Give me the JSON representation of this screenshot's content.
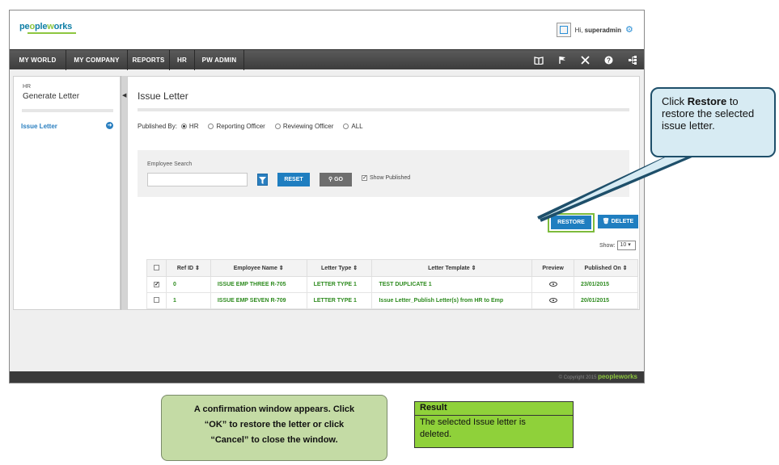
{
  "header": {
    "logo": "peopleworks",
    "greeting_prefix": "Hi,",
    "username": "superadmin"
  },
  "nav": {
    "items": [
      "MY WORLD",
      "MY COMPANY",
      "REPORTS",
      "HR",
      "PW ADMIN"
    ],
    "icons": [
      "book-icon",
      "flag-icon",
      "tools-icon",
      "help-icon",
      "sitemap-icon"
    ]
  },
  "sidebar": {
    "section": "HR",
    "title": "Generate Letter",
    "items": [
      {
        "label": "Issue Letter"
      }
    ]
  },
  "main": {
    "title": "Issue Letter",
    "published_by_label": "Published By:",
    "published_by_options": [
      "HR",
      "Reporting Officer",
      "Reviewing Officer",
      "ALL"
    ],
    "published_by_selected": "HR",
    "search": {
      "label": "Employee Search",
      "value": "",
      "reset_label": "RESET",
      "go_label": "GO",
      "show_published_label": "Show Published",
      "show_published_checked": true
    },
    "restore_label": "RESTORE",
    "delete_label": "DELETE",
    "show_label": "Show:",
    "show_value": "10",
    "table": {
      "columns": [
        "Ref ID",
        "Employee Name",
        "Letter Type",
        "Letter Template",
        "Preview",
        "Published On"
      ],
      "rows": [
        {
          "checked": true,
          "ref_id": "0",
          "employee_name": "ISSUE EMP THREE R-705",
          "letter_type": "LETTER TYPE 1",
          "letter_template": "TEST DUPLICATE 1",
          "published_on": "23/01/2015"
        },
        {
          "checked": false,
          "ref_id": "1",
          "employee_name": "ISSUE EMP SEVEN R-709",
          "letter_type": "LETTER TYPE 1",
          "letter_template": "Issue Letter_Publish Letter(s) from HR to Emp",
          "published_on": "20/01/2015"
        }
      ]
    }
  },
  "footer": {
    "copyright": "© Copyright 2015",
    "brand": "peopleworks"
  },
  "annotations": {
    "callout_pre": "Click ",
    "callout_bold": "Restore",
    "callout_post": " to restore the selected issue letter.",
    "confirm_text_1": "A confirmation window appears. Click",
    "confirm_text_2": "“OK” to restore the letter or click",
    "confirm_text_3": "“Cancel” to close the window.",
    "result_title": "Result",
    "result_text_1": "The  selected Issue letter is",
    "result_text_2": "deleted."
  },
  "colors": {
    "accent_blue": "#1f7ec0",
    "brand_green": "#8dc63f",
    "row_text_green": "#2e8b1f",
    "callout_bg": "#d7ebf3",
    "confirm_bg": "#c4dba5",
    "result_bg": "#8fd13a"
  }
}
